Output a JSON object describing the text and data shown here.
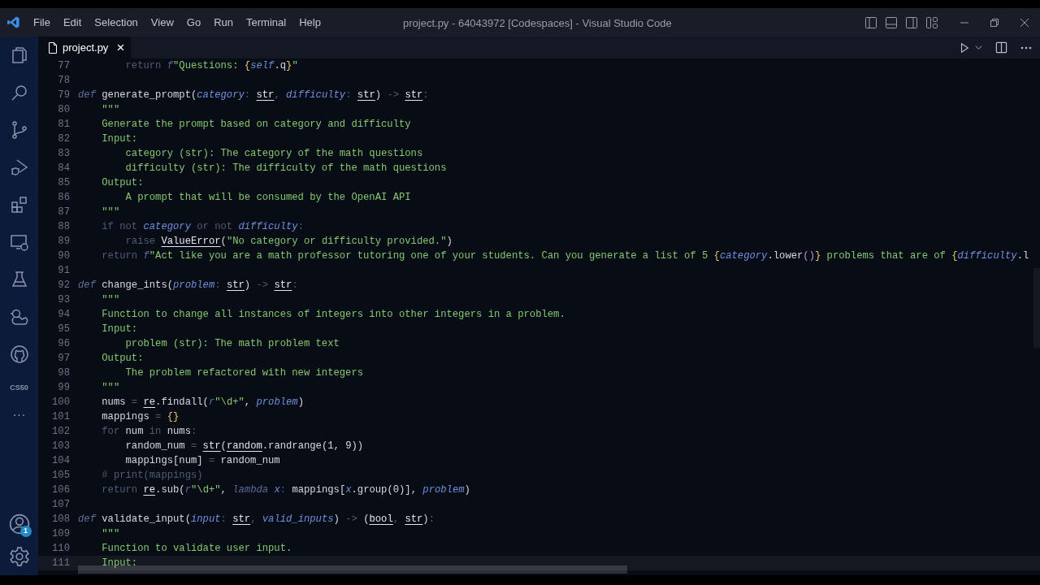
{
  "window": {
    "title": "project.py - 64043972 [Codespaces] - Visual Studio Code"
  },
  "menu": [
    "File",
    "Edit",
    "Selection",
    "View",
    "Go",
    "Run",
    "Terminal",
    "Help"
  ],
  "activity_bar": {
    "cs50_label": "CS50",
    "more": "···",
    "accounts_badge": "1"
  },
  "tabs": [
    {
      "label": "project.py",
      "selected": true,
      "close": "×"
    }
  ],
  "lines": [
    {
      "number": "77",
      "tokens": [
        {
          "kind": "dim",
          "text": "        return "
        },
        {
          "kind": "prefix",
          "text": "f"
        },
        {
          "kind": "str",
          "text": "\"Questions: "
        },
        {
          "kind": "brace",
          "text": "{"
        },
        {
          "kind": "param",
          "text": "self"
        },
        {
          "kind": "plain",
          "text": ".q"
        },
        {
          "kind": "brace",
          "text": "}"
        },
        {
          "kind": "str",
          "text": "\""
        }
      ]
    },
    {
      "number": "78"
    },
    {
      "number": "79",
      "tokens": [
        {
          "kind": "def",
          "text": "def"
        },
        {
          "kind": "plain",
          "text": " generate_prompt("
        },
        {
          "kind": "param",
          "text": "category"
        },
        {
          "kind": "dim",
          "text": ": "
        },
        {
          "kind": "type",
          "text": "str"
        },
        {
          "kind": "dim",
          "text": ", "
        },
        {
          "kind": "param",
          "text": "difficulty"
        },
        {
          "kind": "dim",
          "text": ": "
        },
        {
          "kind": "type",
          "text": "str"
        },
        {
          "kind": "plain",
          "text": ")"
        },
        {
          "kind": "dim",
          "text": " -> "
        },
        {
          "kind": "type",
          "text": "str"
        },
        {
          "kind": "dim",
          "text": ":"
        }
      ]
    },
    {
      "number": "80",
      "tokens": [
        {
          "kind": "str",
          "text": "    \"\"\""
        }
      ]
    },
    {
      "number": "81",
      "tokens": [
        {
          "kind": "str",
          "text": "    Generate the prompt based on category and difficulty"
        }
      ]
    },
    {
      "number": "82",
      "tokens": [
        {
          "kind": "str",
          "text": "    Input:"
        }
      ]
    },
    {
      "number": "83",
      "tokens": [
        {
          "kind": "str",
          "text": "        category (str): The category of the math questions"
        }
      ]
    },
    {
      "number": "84",
      "tokens": [
        {
          "kind": "str",
          "text": "        difficulty (str): The difficulty of the math questions"
        }
      ]
    },
    {
      "number": "85",
      "tokens": [
        {
          "kind": "str",
          "text": "    Output:"
        }
      ]
    },
    {
      "number": "86",
      "tokens": [
        {
          "kind": "str",
          "text": "        A prompt that will be consumed by the OpenAI API"
        }
      ]
    },
    {
      "number": "87",
      "tokens": [
        {
          "kind": "str",
          "text": "    \"\"\""
        }
      ]
    },
    {
      "number": "88",
      "tokens": [
        {
          "kind": "dim",
          "text": "    if not "
        },
        {
          "kind": "param",
          "text": "category"
        },
        {
          "kind": "dim",
          "text": " or not "
        },
        {
          "kind": "param",
          "text": "difficulty"
        },
        {
          "kind": "dim",
          "text": ":"
        }
      ]
    },
    {
      "number": "89",
      "tokens": [
        {
          "kind": "dim",
          "text": "        raise "
        },
        {
          "kind": "type",
          "text": "ValueError"
        },
        {
          "kind": "plain",
          "text": "("
        },
        {
          "kind": "str",
          "text": "\"No category or difficulty provided.\""
        },
        {
          "kind": "plain",
          "text": ")"
        }
      ]
    },
    {
      "number": "90",
      "tokens": [
        {
          "kind": "dim",
          "text": "    return "
        },
        {
          "kind": "prefix",
          "text": "f"
        },
        {
          "kind": "str",
          "text": "\"Act like you are a math professor tutoring one of your students. Can you generate a list of 5 "
        },
        {
          "kind": "brace",
          "text": "{"
        },
        {
          "kind": "param",
          "text": "category"
        },
        {
          "kind": "plain",
          "text": ".lower"
        },
        {
          "kind": "paren",
          "text": "()"
        },
        {
          "kind": "brace",
          "text": "}"
        },
        {
          "kind": "str",
          "text": " problems that are of "
        },
        {
          "kind": "brace",
          "text": "{"
        },
        {
          "kind": "param",
          "text": "difficulty"
        },
        {
          "kind": "plain",
          "text": ".l"
        }
      ]
    },
    {
      "number": "91"
    },
    {
      "number": "92",
      "tokens": [
        {
          "kind": "def",
          "text": "def"
        },
        {
          "kind": "plain",
          "text": " change_ints("
        },
        {
          "kind": "param",
          "text": "problem"
        },
        {
          "kind": "dim",
          "text": ": "
        },
        {
          "kind": "type",
          "text": "str"
        },
        {
          "kind": "plain",
          "text": ")"
        },
        {
          "kind": "dim",
          "text": " -> "
        },
        {
          "kind": "type",
          "text": "str"
        },
        {
          "kind": "dim",
          "text": ":"
        }
      ]
    },
    {
      "number": "93",
      "tokens": [
        {
          "kind": "str",
          "text": "    \"\"\""
        }
      ]
    },
    {
      "number": "94",
      "tokens": [
        {
          "kind": "str",
          "text": "    Function to change all instances of integers into other integers in a problem."
        }
      ]
    },
    {
      "number": "95",
      "tokens": [
        {
          "kind": "str",
          "text": "    Input:"
        }
      ]
    },
    {
      "number": "96",
      "tokens": [
        {
          "kind": "str",
          "text": "        problem (str): The math problem text"
        }
      ]
    },
    {
      "number": "97",
      "tokens": [
        {
          "kind": "str",
          "text": "    Output:"
        }
      ]
    },
    {
      "number": "98",
      "tokens": [
        {
          "kind": "str",
          "text": "        The problem refactored with new integers"
        }
      ]
    },
    {
      "number": "99",
      "tokens": [
        {
          "kind": "str",
          "text": "    \"\"\""
        }
      ]
    },
    {
      "number": "100",
      "tokens": [
        {
          "kind": "plain",
          "text": "    nums "
        },
        {
          "kind": "dim",
          "text": "= "
        },
        {
          "kind": "type",
          "text": "re"
        },
        {
          "kind": "plain",
          "text": ".findall("
        },
        {
          "kind": "prefix",
          "text": "r"
        },
        {
          "kind": "str",
          "text": "\"\\d+\""
        },
        {
          "kind": "plain",
          "text": ", "
        },
        {
          "kind": "param",
          "text": "problem"
        },
        {
          "kind": "plain",
          "text": ")"
        }
      ]
    },
    {
      "number": "101",
      "tokens": [
        {
          "kind": "plain",
          "text": "    mappings "
        },
        {
          "kind": "dim",
          "text": "= "
        },
        {
          "kind": "brace",
          "text": "{}"
        }
      ]
    },
    {
      "number": "102",
      "tokens": [
        {
          "kind": "dim",
          "text": "    for "
        },
        {
          "kind": "plain",
          "text": "num "
        },
        {
          "kind": "dim",
          "text": "in "
        },
        {
          "kind": "plain",
          "text": "nums"
        },
        {
          "kind": "dim",
          "text": ":"
        }
      ]
    },
    {
      "number": "103",
      "tokens": [
        {
          "kind": "plain",
          "text": "        random_num "
        },
        {
          "kind": "dim",
          "text": "= "
        },
        {
          "kind": "type",
          "text": "str"
        },
        {
          "kind": "plain",
          "text": "("
        },
        {
          "kind": "type",
          "text": "random"
        },
        {
          "kind": "plain",
          "text": ".randrange(1, 9))"
        }
      ]
    },
    {
      "number": "104",
      "tokens": [
        {
          "kind": "plain",
          "text": "        mappings[num] "
        },
        {
          "kind": "dim",
          "text": "= "
        },
        {
          "kind": "plain",
          "text": "random_num"
        }
      ]
    },
    {
      "number": "105",
      "tokens": [
        {
          "kind": "dim",
          "text": "    # print(mappings)"
        }
      ]
    },
    {
      "number": "106",
      "tokens": [
        {
          "kind": "dim",
          "text": "    return "
        },
        {
          "kind": "type",
          "text": "re"
        },
        {
          "kind": "plain",
          "text": ".sub("
        },
        {
          "kind": "prefix",
          "text": "r"
        },
        {
          "kind": "str",
          "text": "\"\\d+\""
        },
        {
          "kind": "plain",
          "text": ", "
        },
        {
          "kind": "prefix",
          "text": "lambda "
        },
        {
          "kind": "param",
          "text": "x"
        },
        {
          "kind": "dim",
          "text": ": "
        },
        {
          "kind": "plain",
          "text": "mappings["
        },
        {
          "kind": "param",
          "text": "x"
        },
        {
          "kind": "plain",
          "text": ".group(0)], "
        },
        {
          "kind": "param",
          "text": "problem"
        },
        {
          "kind": "plain",
          "text": ")"
        }
      ]
    },
    {
      "number": "107"
    },
    {
      "number": "108",
      "tokens": [
        {
          "kind": "def",
          "text": "def"
        },
        {
          "kind": "plain",
          "text": " validate_input("
        },
        {
          "kind": "param",
          "text": "input"
        },
        {
          "kind": "dim",
          "text": ": "
        },
        {
          "kind": "type",
          "text": "str"
        },
        {
          "kind": "dim",
          "text": ", "
        },
        {
          "kind": "param",
          "text": "valid_inputs"
        },
        {
          "kind": "plain",
          "text": ")"
        },
        {
          "kind": "dim",
          "text": " -> "
        },
        {
          "kind": "plain",
          "text": "("
        },
        {
          "kind": "type",
          "text": "bool"
        },
        {
          "kind": "dim",
          "text": ", "
        },
        {
          "kind": "type",
          "text": "str"
        },
        {
          "kind": "plain",
          "text": ")"
        },
        {
          "kind": "dim",
          "text": ":"
        }
      ]
    },
    {
      "number": "109",
      "tokens": [
        {
          "kind": "str",
          "text": "    \"\"\""
        }
      ]
    },
    {
      "number": "110",
      "tokens": [
        {
          "kind": "str",
          "text": "    Function to validate user input."
        }
      ]
    },
    {
      "number": "111",
      "tokens": [
        {
          "kind": "str",
          "text": "    Input:"
        }
      ]
    }
  ]
}
